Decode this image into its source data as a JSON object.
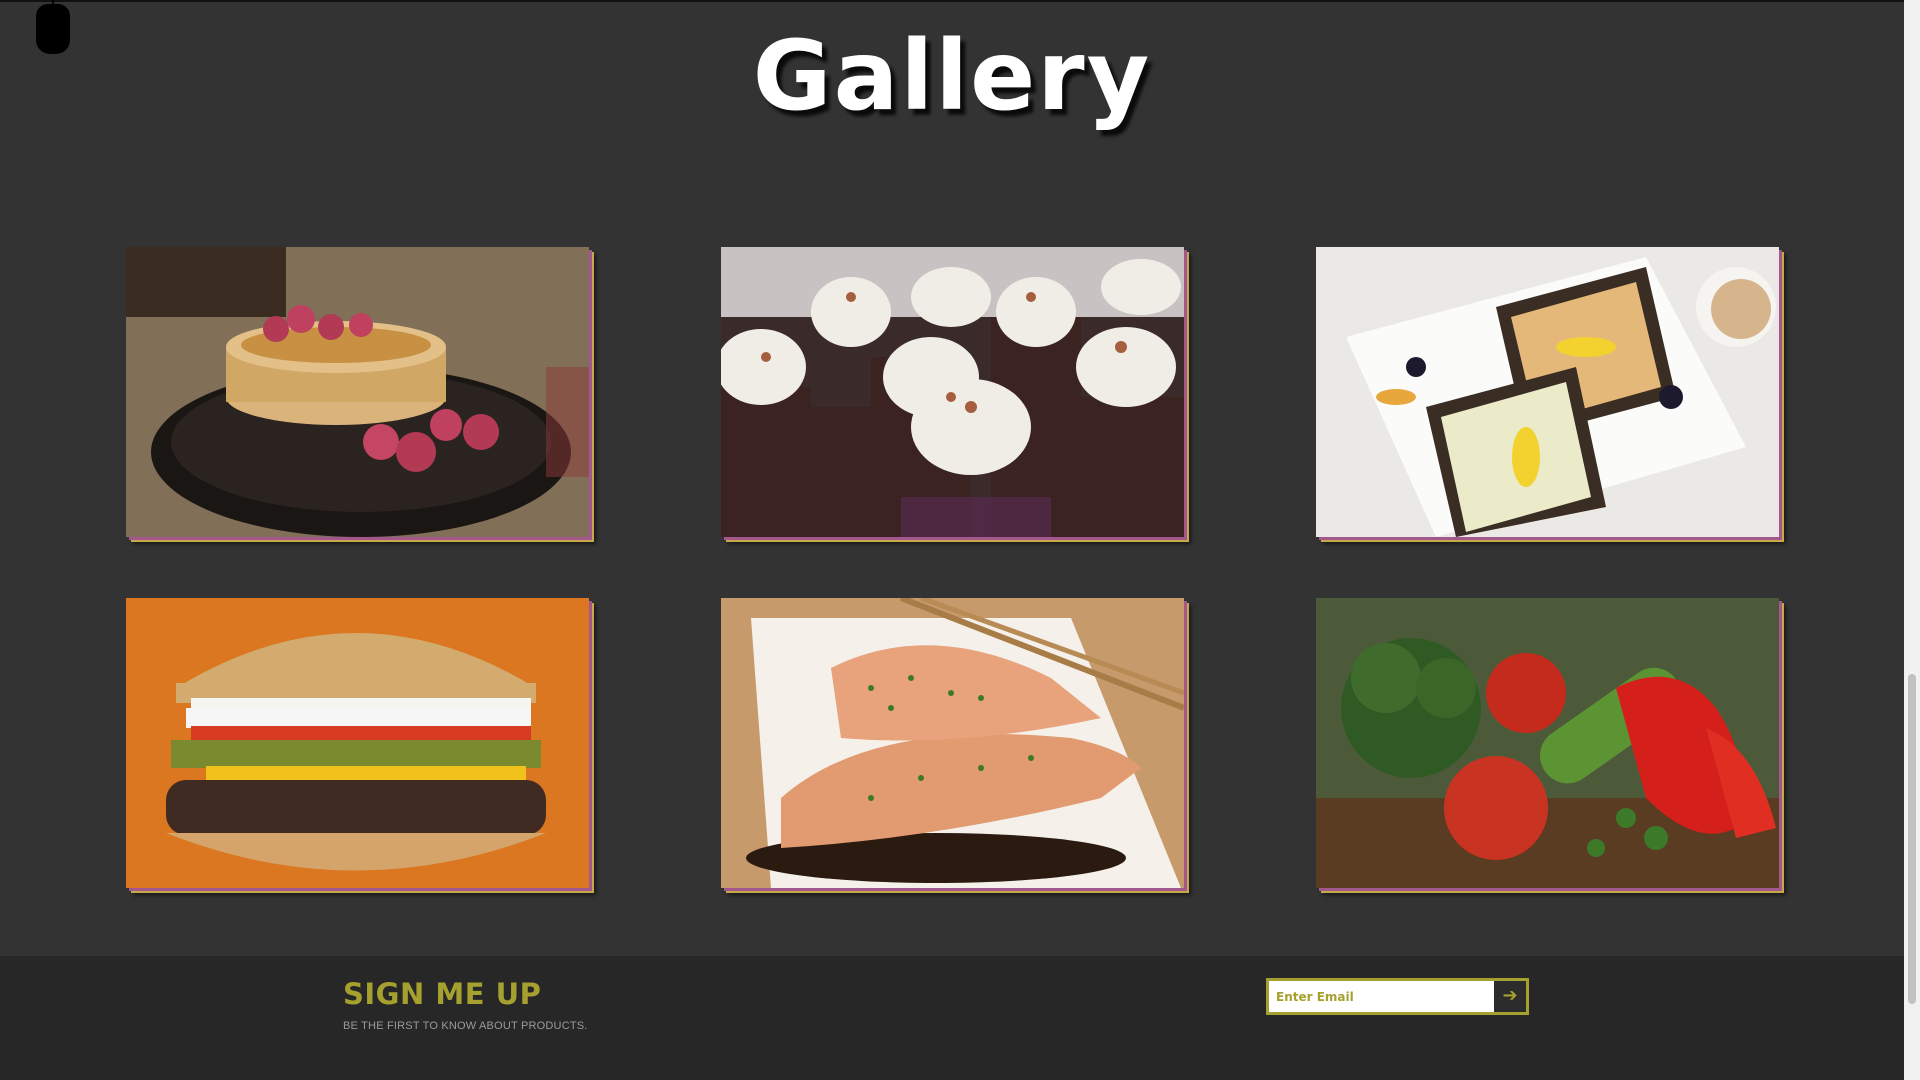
{
  "page": {
    "title": "Gallery"
  },
  "gallery": {
    "items": [
      {
        "name": "pancakes-photo",
        "alt": "pancakes"
      },
      {
        "name": "cupcakes-photo",
        "alt": "cupcakes"
      },
      {
        "name": "toast-platter-photo",
        "alt": "toast platter"
      },
      {
        "name": "burger-photo",
        "alt": "burger"
      },
      {
        "name": "salmon-photo",
        "alt": "salmon"
      },
      {
        "name": "vegetables-photo",
        "alt": "vegetables"
      }
    ]
  },
  "signup": {
    "title": "SIGN ME UP",
    "subtitle": "BE THE FIRST TO KNOW ABOUT PRODUCTS.",
    "email_placeholder": "Enter Email",
    "submit_icon": "arrow-right-icon"
  },
  "colors": {
    "background": "#333333",
    "footer": "#272727",
    "accent": "#a6a02e"
  }
}
